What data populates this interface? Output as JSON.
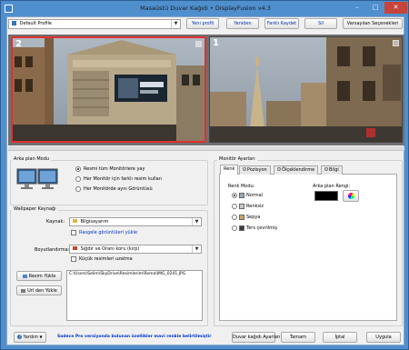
{
  "window": {
    "title": "Masaüstü Duvar Kağıdı • DisplayFusion v4.3",
    "controls": [
      "–",
      "□",
      "✕"
    ]
  },
  "toolbar": {
    "profile_value": "Default Profile",
    "buttons": [
      "Yeni profil",
      "Yeniden",
      "Farklı Kaydet",
      "Sil",
      "Varsayılan Seçenekleri"
    ]
  },
  "preview": {
    "monitors": [
      {
        "number": "2",
        "selected": true
      },
      {
        "number": "1",
        "selected": false
      }
    ]
  },
  "bg_mode": {
    "group_label": "Arka plan Modu",
    "options": [
      {
        "label": "Resmi tüm Monitörlere yay",
        "selected": true
      },
      {
        "label": "Her Monitör için farklı resim kullan",
        "selected": false
      },
      {
        "label": "Her Monitörde aynı Görüntüsü",
        "selected": false
      }
    ]
  },
  "source": {
    "group_label": "Wallpaper Kaynağı",
    "source_label": "Kaynak:",
    "source_value": "Bilgisayarım",
    "random_link": "Rasgele görüntüleri yükle",
    "sizing_label": "Boyutlandırma:",
    "sizing_value": "Sığdır ve Oranı koru (kırp)",
    "shrink_label": "Küçük resimleri uzatma",
    "load_image_button": "Resim Yükle",
    "load_url_button": "Url den Yükle",
    "path": "C:\\Users\\Selim\\SkyDrive\\Resimlerim\\Roma\\IMG_0241.JPG"
  },
  "monitor_settings": {
    "group_label": "Monitör Ayarları",
    "tabs": [
      "Renk",
      "Pozisyon",
      "Ölçeklendirme",
      "Bilgi"
    ],
    "color_mode_label": "Renk Modu:",
    "color_modes": [
      {
        "label": "Normal",
        "selected": true,
        "color": "#9aa6b4"
      },
      {
        "label": "Renksiz",
        "selected": false,
        "color": "#c8c8c8"
      },
      {
        "label": "Sepya",
        "selected": false,
        "color": "#c9a36a"
      },
      {
        "label": "Ters çevrilmiş",
        "selected": false,
        "color": "#3b3b3b"
      }
    ],
    "bg_color_label": "Arka plan Rengi:",
    "bg_color": "#000000"
  },
  "footer": {
    "help_button": "Yardım",
    "pro_notice": "Sadece Pro versiyonda bulunan özellikler mavi renkle belirtilmiştir",
    "buttons": [
      "Duvar kağıdı Ayarları",
      "Tamam",
      "İptal",
      "Uygula"
    ]
  },
  "colors": {
    "accent_blue": "#0033cc",
    "title_bar": "#4f8fce",
    "selected_monitor_border": "#e03030"
  }
}
